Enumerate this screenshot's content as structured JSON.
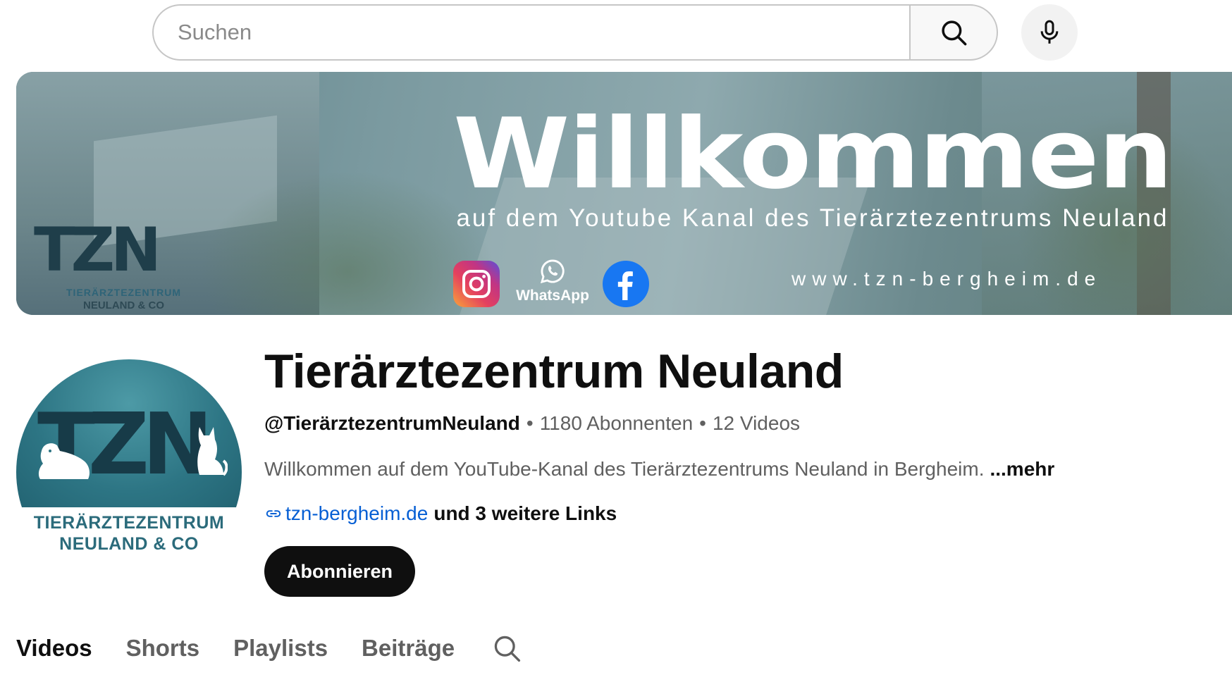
{
  "search": {
    "placeholder": "Suchen",
    "value": ""
  },
  "banner": {
    "title": "Willkommen",
    "subtitle": "auf dem Youtube Kanal des Tierärztezentrums Neuland",
    "url": "www.tzn-bergheim.de",
    "logo": {
      "mark": "TZN",
      "line1": "TIERÄRZTEZENTRUM",
      "line2": "NEULAND & CO"
    },
    "social": {
      "whatsapp_label": "WhatsApp"
    }
  },
  "avatar": {
    "mark": "TZN",
    "line1": "TIERÄRZTEZENTRUM",
    "line2": "NEULAND & CO"
  },
  "channel": {
    "name": "Tierärztezentrum Neuland",
    "handle": "@TierärztezentrumNeuland",
    "subscribers": "1180 Abonnenten",
    "videos": "12 Videos",
    "separator": "•",
    "description": "Willkommen auf dem YouTube-Kanal des Tierärztezentrums Neuland in Bergheim.",
    "more_label": "...mehr",
    "link_url": "tzn-bergheim.de",
    "more_links": "und 3 weitere Links",
    "subscribe_label": "Abonnieren"
  },
  "tabs": [
    {
      "label": "Videos",
      "active": true
    },
    {
      "label": "Shorts",
      "active": false
    },
    {
      "label": "Playlists",
      "active": false
    },
    {
      "label": "Beiträge",
      "active": false
    }
  ],
  "colors": {
    "link": "#065fd4",
    "subscribe_bg": "#0f0f0f",
    "teal": "#2b6b7b",
    "facebook": "#1877f2"
  },
  "icons": [
    "search-icon",
    "mic-icon",
    "instagram-icon",
    "whatsapp-icon",
    "facebook-icon",
    "link-icon",
    "tab-search-icon"
  ]
}
